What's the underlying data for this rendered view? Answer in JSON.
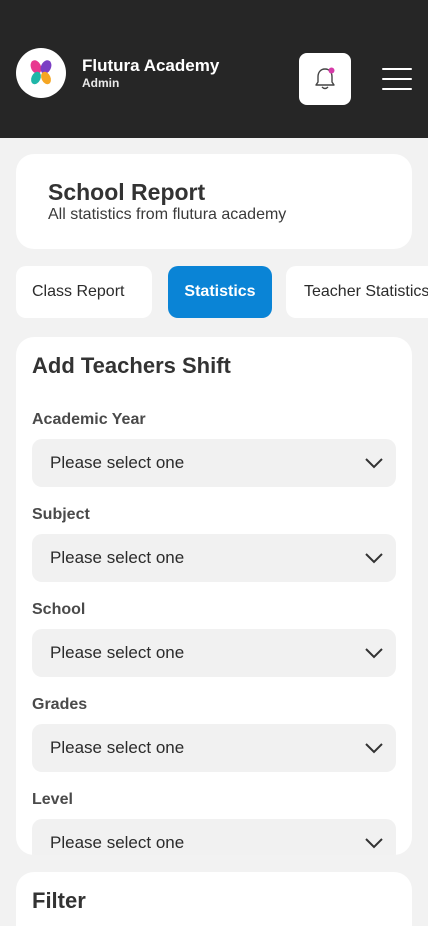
{
  "header": {
    "brand_name": "Flutura Academy",
    "brand_role": "Admin",
    "logo_icon": "flutura-butterfly-logo",
    "notification_icon": "bell-icon",
    "menu_icon": "hamburger-menu-icon",
    "colors": {
      "bar": "#262626",
      "notification_dot": "#d63aa8"
    }
  },
  "report": {
    "title": "School Report",
    "subtitle": "All statistics from flutura academy"
  },
  "tabs": [
    {
      "label": "Class Report",
      "active": false
    },
    {
      "label": "Statistics",
      "active": true
    },
    {
      "label": "Teacher Statistics",
      "active": false
    }
  ],
  "accent_color": "#0a84d6",
  "form": {
    "title": "Add Teachers Shift",
    "fields": [
      {
        "label": "Academic Year",
        "value": "Please select one"
      },
      {
        "label": "Subject",
        "value": "Please select one"
      },
      {
        "label": "School",
        "value": "Please select one"
      },
      {
        "label": "Grades",
        "value": "Please select one"
      },
      {
        "label": "Level",
        "value": "Please select one"
      }
    ]
  },
  "filter": {
    "title": "Filter"
  }
}
